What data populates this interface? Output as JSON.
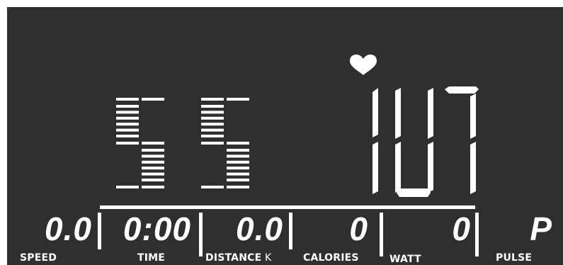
{
  "display": {
    "program_digits": "55",
    "pulse_value": "107",
    "heart_icon": "heart-icon",
    "colors": {
      "background": "#2f2f2f",
      "segments": "#ffffff"
    }
  },
  "stats": [
    {
      "key": "speed",
      "value": "0.0",
      "label": "SPEED"
    },
    {
      "key": "time",
      "value": "0:00",
      "label": "TIME"
    },
    {
      "key": "distance",
      "value": "0.0",
      "label": "DISTANCE",
      "unit": "K"
    },
    {
      "key": "calories",
      "value": "0",
      "label": "CALORIES"
    },
    {
      "key": "watt",
      "value": "0",
      "label": "WATT"
    },
    {
      "key": "pulse",
      "value": "P",
      "label": "PULSE"
    }
  ]
}
